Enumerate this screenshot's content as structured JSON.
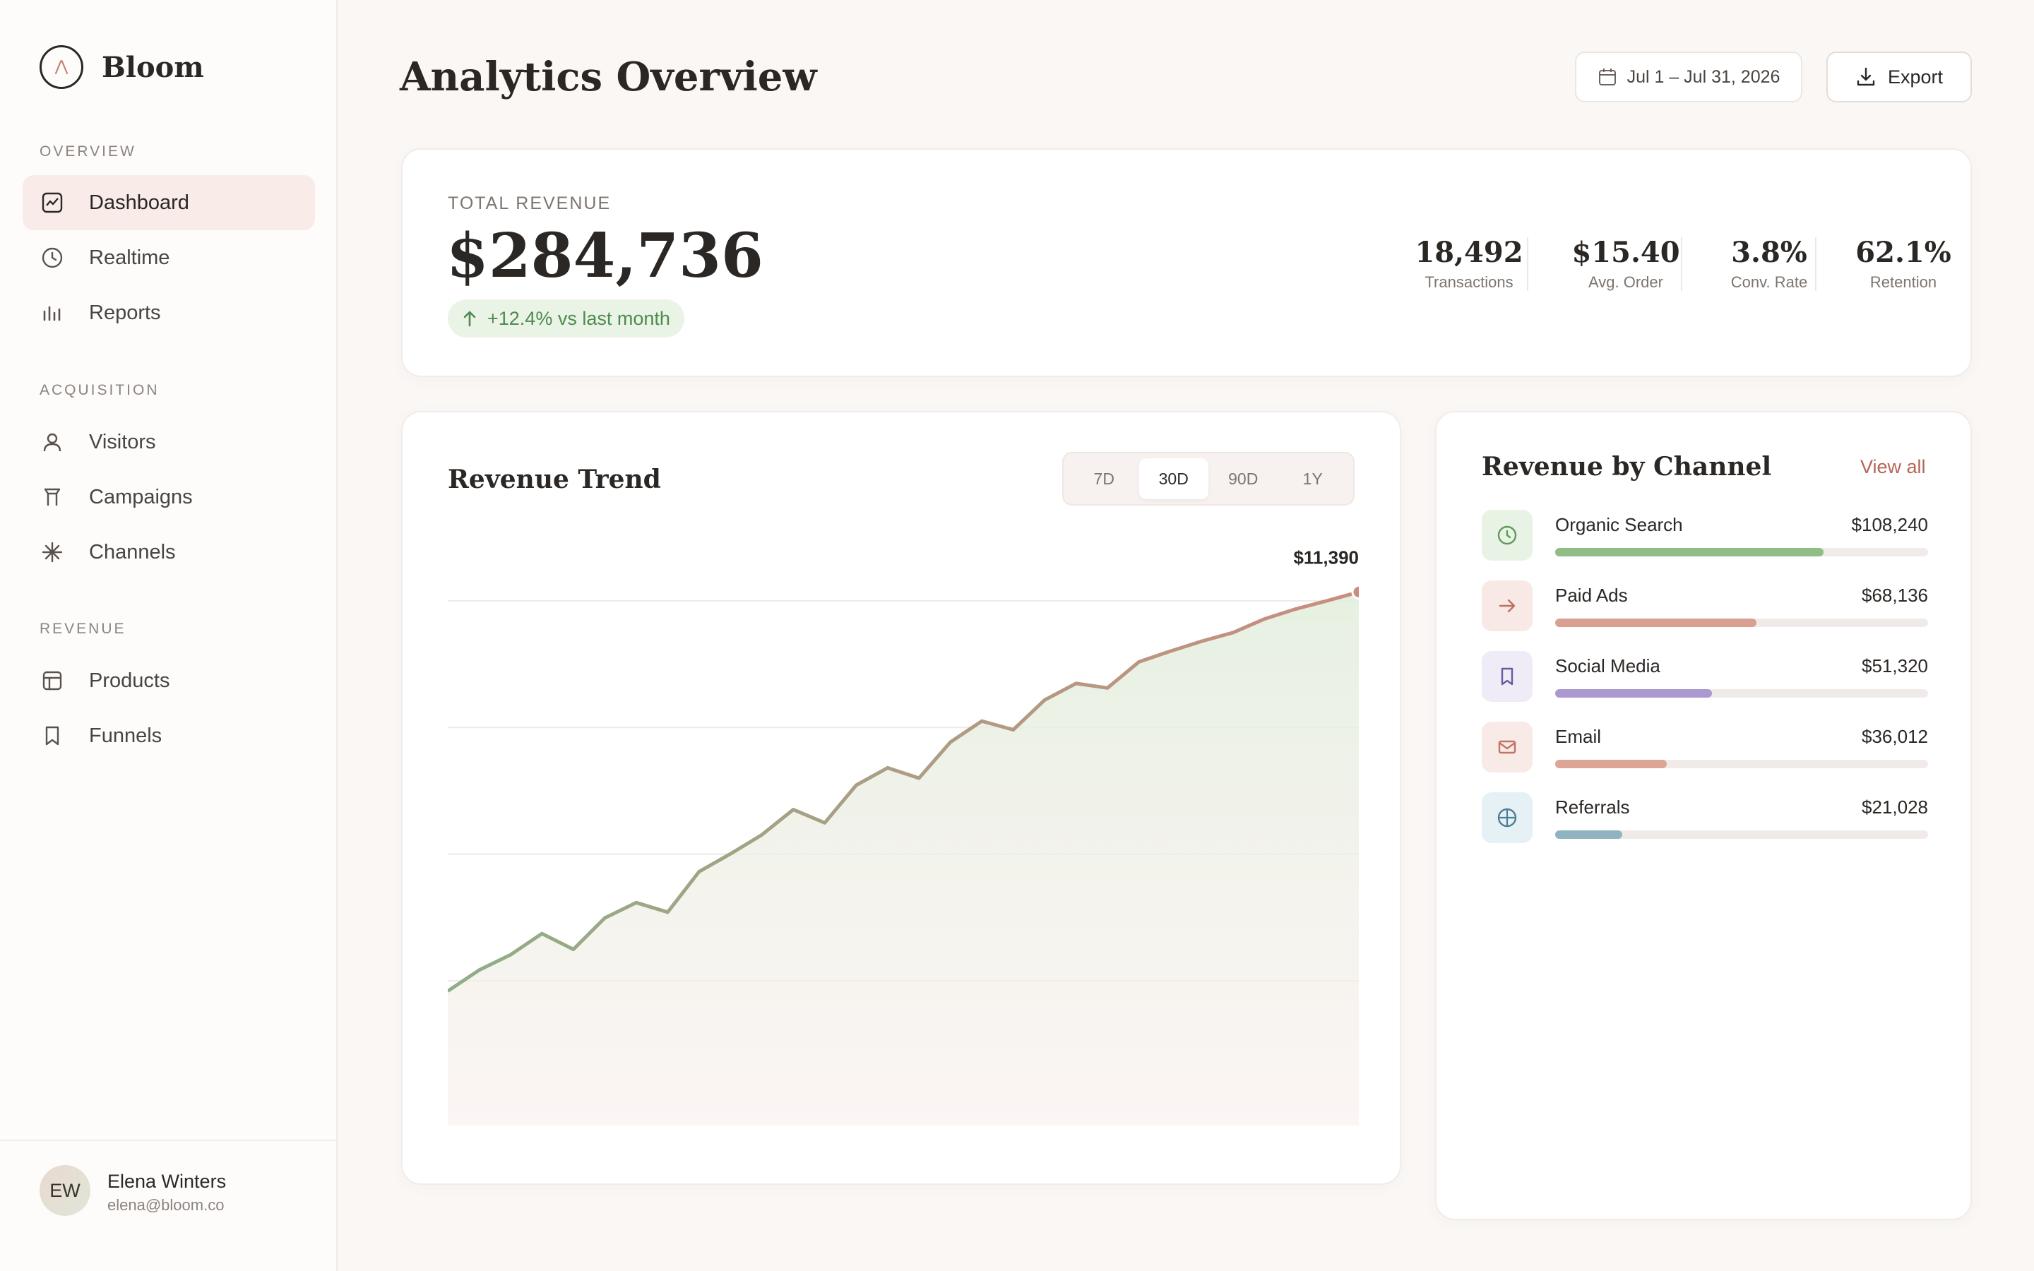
{
  "brand": {
    "name": "Bloom"
  },
  "sidebar": {
    "sections": [
      {
        "label": "OVERVIEW",
        "items": [
          {
            "label": "Dashboard",
            "icon": "chart-icon",
            "active": true
          },
          {
            "label": "Realtime",
            "icon": "clock-icon"
          },
          {
            "label": "Reports",
            "icon": "bars-icon"
          }
        ]
      },
      {
        "label": "ACQUISITION",
        "items": [
          {
            "label": "Visitors",
            "icon": "user-icon"
          },
          {
            "label": "Campaigns",
            "icon": "flag-icon"
          },
          {
            "label": "Channels",
            "icon": "asterisk-icon"
          }
        ]
      },
      {
        "label": "REVENUE",
        "items": [
          {
            "label": "Products",
            "icon": "table-icon"
          },
          {
            "label": "Funnels",
            "icon": "bookmark-icon"
          }
        ]
      }
    ]
  },
  "user": {
    "initials": "EW",
    "name": "Elena Winters",
    "email": "elena@bloom.co"
  },
  "header": {
    "title": "Analytics Overview",
    "date_range": "Jul 1 – Jul 31, 2026",
    "export_label": "Export"
  },
  "revenue": {
    "label": "TOTAL REVENUE",
    "value": "$284,736",
    "change": "+12.4% vs last month",
    "stats": [
      {
        "value": "18,492",
        "label": "Transactions"
      },
      {
        "value": "$15.40",
        "label": "Avg. Order"
      },
      {
        "value": "3.8%",
        "label": "Conv. Rate"
      },
      {
        "value": "62.1%",
        "label": "Retention"
      }
    ]
  },
  "trend": {
    "title": "Revenue Trend",
    "ranges": [
      "7D",
      "30D",
      "90D",
      "1Y"
    ],
    "active_range": "30D",
    "last_label": "$11,390"
  },
  "channels": {
    "title": "Revenue by Channel",
    "view_all": "View all",
    "items": [
      {
        "name": "Organic Search",
        "value": "$108,240",
        "share": 0.72,
        "icon": "clock-icon",
        "color": "#8fbd85",
        "bg": "#e8f3e6",
        "stroke": "#5f9b5a"
      },
      {
        "name": "Paid Ads",
        "value": "$68,136",
        "share": 0.54,
        "icon": "arrow-right-icon",
        "color": "#d8a092",
        "bg": "#f8e9e6",
        "stroke": "#c06e60"
      },
      {
        "name": "Social Media",
        "value": "$51,320",
        "share": 0.42,
        "icon": "bookmark-icon",
        "color": "#ab98cf",
        "bg": "#efebf7",
        "stroke": "#6d5a9e"
      },
      {
        "name": "Email",
        "value": "$36,012",
        "share": 0.3,
        "icon": "mail-icon",
        "color": "#dca596",
        "bg": "#f8ebe7",
        "stroke": "#c07464"
      },
      {
        "name": "Referrals",
        "value": "$21,028",
        "share": 0.18,
        "icon": "globe-icon",
        "color": "#8fb4c0",
        "bg": "#e6f1f6",
        "stroke": "#4d7f96"
      }
    ]
  },
  "chart_data": {
    "type": "area",
    "title": "Revenue Trend",
    "x": [
      1,
      2,
      3,
      4,
      5,
      6,
      7,
      8,
      9,
      10,
      11,
      12,
      13,
      14,
      15,
      16,
      17,
      18,
      19,
      20,
      21,
      22,
      23,
      24,
      25,
      26,
      27,
      28,
      29,
      30
    ],
    "series": [
      {
        "values": [
          3250,
          3760,
          4130,
          4640,
          4260,
          5020,
          5390,
          5160,
          6140,
          6570,
          7030,
          7640,
          7320,
          8230,
          8650,
          8400,
          9270,
          9780,
          9570,
          10290,
          10690,
          10580,
          11210,
          11470,
          11710,
          11920,
          12250,
          12490,
          12690,
          12900
        ]
      }
    ],
    "annotations": [
      {
        "x": 30,
        "label": "$11,390"
      }
    ],
    "grid": true,
    "colors": {
      "start": "#8fae87",
      "end": "#c98c80"
    }
  }
}
